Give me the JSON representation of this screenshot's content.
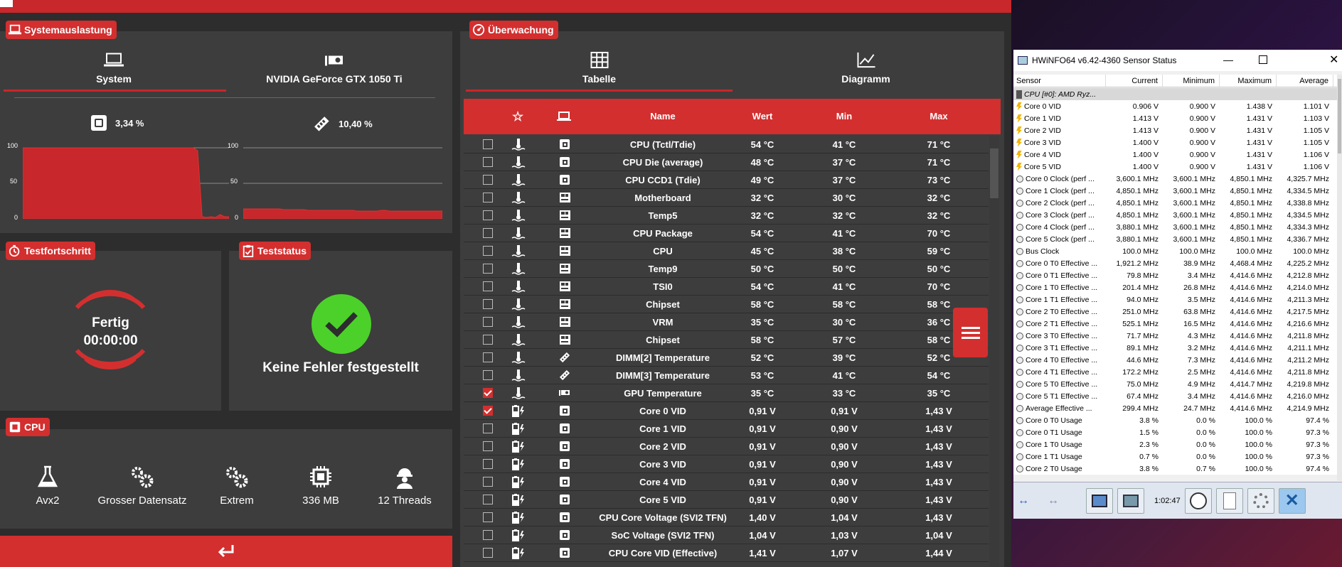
{
  "system_panel": {
    "badge": "Systemauslastung",
    "tabs": [
      {
        "label": "System",
        "icon": "laptop-icon"
      },
      {
        "label": "NVIDIA GeForce GTX 1050 Ti",
        "icon": "gpu-icon"
      }
    ],
    "cpu_usage": "3,34 %",
    "ram_usage": "10,40 %",
    "chart_ticks": [
      "100",
      "50",
      "0"
    ],
    "cpu_chart_values": [
      100,
      100,
      100,
      100,
      100,
      100,
      100,
      100,
      100,
      100,
      100,
      100,
      100,
      100,
      100,
      100,
      100,
      100,
      100,
      100,
      100,
      100,
      100,
      100,
      100,
      100,
      100,
      100,
      100,
      100,
      100,
      100,
      100,
      100,
      100,
      100,
      100,
      100,
      100,
      96,
      3,
      2,
      3,
      2,
      6,
      3,
      3
    ],
    "ram_chart_values": [
      14,
      14,
      14,
      14,
      14,
      14,
      14,
      14,
      14,
      14,
      13,
      13,
      13,
      13,
      13,
      13,
      12,
      12,
      12,
      12,
      12,
      12,
      12,
      12,
      12,
      12,
      12,
      12,
      11,
      11,
      11,
      11,
      11,
      11,
      12,
      12,
      11,
      11,
      11,
      11,
      11,
      11,
      11,
      11,
      11,
      11,
      11,
      11,
      11,
      11
    ]
  },
  "test_progress": {
    "badge": "Testfortschritt",
    "status": "Fertig",
    "time": "00:00:00"
  },
  "test_status": {
    "badge": "Teststatus",
    "message": "Keine Fehler festgestellt"
  },
  "cpu_panel": {
    "badge": "CPU",
    "items": [
      {
        "label": "Avx2",
        "icon": "flask-icon"
      },
      {
        "label": "Grosser Datensatz",
        "icon": "gears-icon"
      },
      {
        "label": "Extrem",
        "icon": "gears-icon"
      },
      {
        "label": "336 MB",
        "icon": "chip-icon"
      },
      {
        "label": "12 Threads",
        "icon": "worker-icon"
      }
    ]
  },
  "monitor": {
    "badge": "Überwachung",
    "tabs": [
      {
        "label": "Tabelle",
        "icon": "grid-icon"
      },
      {
        "label": "Diagramm",
        "icon": "line-chart-icon"
      }
    ],
    "columns": {
      "star": "star-icon",
      "device": "laptop-icon",
      "name": "Name",
      "value": "Wert",
      "min": "Min",
      "max": "Max"
    },
    "rows": [
      {
        "checked": false,
        "type": "temp",
        "dev": "cpu",
        "name": "CPU (Tctl/Tdie)",
        "value": "54 °C",
        "min": "41 °C",
        "max": "71 °C"
      },
      {
        "checked": false,
        "type": "temp",
        "dev": "cpu",
        "name": "CPU Die (average)",
        "value": "48 °C",
        "min": "37 °C",
        "max": "71 °C"
      },
      {
        "checked": false,
        "type": "temp",
        "dev": "cpu",
        "name": "CPU CCD1 (Tdie)",
        "value": "49 °C",
        "min": "37 °C",
        "max": "73 °C"
      },
      {
        "checked": false,
        "type": "temp",
        "dev": "board",
        "name": "Motherboard",
        "value": "32 °C",
        "min": "30 °C",
        "max": "32 °C"
      },
      {
        "checked": false,
        "type": "temp",
        "dev": "board",
        "name": "Temp5",
        "value": "32 °C",
        "min": "32 °C",
        "max": "32 °C"
      },
      {
        "checked": false,
        "type": "temp",
        "dev": "board",
        "name": "CPU Package",
        "value": "54 °C",
        "min": "41 °C",
        "max": "70 °C"
      },
      {
        "checked": false,
        "type": "temp",
        "dev": "board",
        "name": "CPU",
        "value": "45 °C",
        "min": "38 °C",
        "max": "59 °C"
      },
      {
        "checked": false,
        "type": "temp",
        "dev": "board",
        "name": "Temp9",
        "value": "50 °C",
        "min": "50 °C",
        "max": "50 °C"
      },
      {
        "checked": false,
        "type": "temp",
        "dev": "board",
        "name": "TSI0",
        "value": "54 °C",
        "min": "41 °C",
        "max": "70 °C"
      },
      {
        "checked": false,
        "type": "temp",
        "dev": "board",
        "name": "Chipset",
        "value": "58 °C",
        "min": "58 °C",
        "max": "58 °C"
      },
      {
        "checked": false,
        "type": "temp",
        "dev": "board",
        "name": "VRM",
        "value": "35 °C",
        "min": "30 °C",
        "max": "36 °C"
      },
      {
        "checked": false,
        "type": "temp",
        "dev": "board",
        "name": "Chipset",
        "value": "58 °C",
        "min": "57 °C",
        "max": "58 °C"
      },
      {
        "checked": false,
        "type": "temp",
        "dev": "ram",
        "name": "DIMM[2] Temperature",
        "value": "52 °C",
        "min": "39 °C",
        "max": "52 °C"
      },
      {
        "checked": false,
        "type": "temp",
        "dev": "ram",
        "name": "DIMM[3] Temperature",
        "value": "53 °C",
        "min": "41 °C",
        "max": "54 °C"
      },
      {
        "checked": true,
        "type": "temp",
        "dev": "gpu",
        "name": "GPU Temperature",
        "value": "35 °C",
        "min": "33 °C",
        "max": "35 °C"
      },
      {
        "checked": true,
        "type": "volt",
        "dev": "cpu",
        "name": "Core 0 VID",
        "value": "0,91 V",
        "min": "0,91 V",
        "max": "1,43 V"
      },
      {
        "checked": false,
        "type": "volt",
        "dev": "cpu",
        "name": "Core 1 VID",
        "value": "0,91 V",
        "min": "0,90 V",
        "max": "1,43 V"
      },
      {
        "checked": false,
        "type": "volt",
        "dev": "cpu",
        "name": "Core 2 VID",
        "value": "0,91 V",
        "min": "0,90 V",
        "max": "1,43 V"
      },
      {
        "checked": false,
        "type": "volt",
        "dev": "cpu",
        "name": "Core 3 VID",
        "value": "0,91 V",
        "min": "0,90 V",
        "max": "1,43 V"
      },
      {
        "checked": false,
        "type": "volt",
        "dev": "cpu",
        "name": "Core 4 VID",
        "value": "0,91 V",
        "min": "0,90 V",
        "max": "1,43 V"
      },
      {
        "checked": false,
        "type": "volt",
        "dev": "cpu",
        "name": "Core 5 VID",
        "value": "0,91 V",
        "min": "0,90 V",
        "max": "1,43 V"
      },
      {
        "checked": false,
        "type": "volt",
        "dev": "cpu",
        "name": "CPU Core Voltage (SVI2 TFN)",
        "value": "1,40 V",
        "min": "1,04 V",
        "max": "1,43 V"
      },
      {
        "checked": false,
        "type": "volt",
        "dev": "cpu",
        "name": "SoC Voltage (SVI2 TFN)",
        "value": "1,04 V",
        "min": "1,03 V",
        "max": "1,04 V"
      },
      {
        "checked": false,
        "type": "volt",
        "dev": "cpu",
        "name": "CPU Core VID (Effective)",
        "value": "1,41 V",
        "min": "1,07 V",
        "max": "1,44 V"
      }
    ]
  },
  "hwinfo": {
    "title": "HWiNFO64 v6.42-4360 Sensor Status",
    "columns": [
      "Sensor",
      "Current",
      "Minimum",
      "Maximum",
      "Average"
    ],
    "group": "CPU [#0]: AMD Ryz...",
    "rows": [
      {
        "icon": "volt",
        "name": "Core 0 VID",
        "cur": "0.906 V",
        "min": "0.900 V",
        "max": "1.438 V",
        "avg": "1.101 V"
      },
      {
        "icon": "volt",
        "name": "Core 1 VID",
        "cur": "1.413 V",
        "min": "0.900 V",
        "max": "1.431 V",
        "avg": "1.103 V"
      },
      {
        "icon": "volt",
        "name": "Core 2 VID",
        "cur": "1.413 V",
        "min": "0.900 V",
        "max": "1.431 V",
        "avg": "1.105 V"
      },
      {
        "icon": "volt",
        "name": "Core 3 VID",
        "cur": "1.400 V",
        "min": "0.900 V",
        "max": "1.431 V",
        "avg": "1.105 V"
      },
      {
        "icon": "volt",
        "name": "Core 4 VID",
        "cur": "1.400 V",
        "min": "0.900 V",
        "max": "1.431 V",
        "avg": "1.106 V"
      },
      {
        "icon": "volt",
        "name": "Core 5 VID",
        "cur": "1.400 V",
        "min": "0.900 V",
        "max": "1.431 V",
        "avg": "1.106 V"
      },
      {
        "icon": "clock",
        "name": "Core 0 Clock (perf ...",
        "cur": "3,600.1 MHz",
        "min": "3,600.1 MHz",
        "max": "4,850.1 MHz",
        "avg": "4,325.7 MHz"
      },
      {
        "icon": "clock",
        "name": "Core 1 Clock (perf ...",
        "cur": "4,850.1 MHz",
        "min": "3,600.1 MHz",
        "max": "4,850.1 MHz",
        "avg": "4,334.5 MHz"
      },
      {
        "icon": "clock",
        "name": "Core 2 Clock (perf ...",
        "cur": "4,850.1 MHz",
        "min": "3,600.1 MHz",
        "max": "4,850.1 MHz",
        "avg": "4,338.8 MHz"
      },
      {
        "icon": "clock",
        "name": "Core 3 Clock (perf ...",
        "cur": "4,850.1 MHz",
        "min": "3,600.1 MHz",
        "max": "4,850.1 MHz",
        "avg": "4,334.5 MHz"
      },
      {
        "icon": "clock",
        "name": "Core 4 Clock (perf ...",
        "cur": "3,880.1 MHz",
        "min": "3,600.1 MHz",
        "max": "4,850.1 MHz",
        "avg": "4,334.3 MHz"
      },
      {
        "icon": "clock",
        "name": "Core 5 Clock (perf ...",
        "cur": "3,880.1 MHz",
        "min": "3,600.1 MHz",
        "max": "4,850.1 MHz",
        "avg": "4,336.7 MHz"
      },
      {
        "icon": "clock",
        "name": "Bus Clock",
        "cur": "100.0 MHz",
        "min": "100.0 MHz",
        "max": "100.0 MHz",
        "avg": "100.0 MHz"
      },
      {
        "icon": "clock",
        "name": "Core 0 T0 Effective ...",
        "cur": "1,921.2 MHz",
        "min": "38.9 MHz",
        "max": "4,468.4 MHz",
        "avg": "4,225.2 MHz"
      },
      {
        "icon": "clock",
        "name": "Core 0 T1 Effective ...",
        "cur": "79.8 MHz",
        "min": "3.4 MHz",
        "max": "4,414.6 MHz",
        "avg": "4,212.8 MHz"
      },
      {
        "icon": "clock",
        "name": "Core 1 T0 Effective ...",
        "cur": "201.4 MHz",
        "min": "26.8 MHz",
        "max": "4,414.6 MHz",
        "avg": "4,214.0 MHz"
      },
      {
        "icon": "clock",
        "name": "Core 1 T1 Effective ...",
        "cur": "94.0 MHz",
        "min": "3.5 MHz",
        "max": "4,414.6 MHz",
        "avg": "4,211.3 MHz"
      },
      {
        "icon": "clock",
        "name": "Core 2 T0 Effective ...",
        "cur": "251.0 MHz",
        "min": "63.8 MHz",
        "max": "4,414.6 MHz",
        "avg": "4,217.5 MHz"
      },
      {
        "icon": "clock",
        "name": "Core 2 T1 Effective ...",
        "cur": "525.1 MHz",
        "min": "16.5 MHz",
        "max": "4,414.6 MHz",
        "avg": "4,216.6 MHz"
      },
      {
        "icon": "clock",
        "name": "Core 3 T0 Effective ...",
        "cur": "71.7 MHz",
        "min": "4.3 MHz",
        "max": "4,414.6 MHz",
        "avg": "4,211.8 MHz"
      },
      {
        "icon": "clock",
        "name": "Core 3 T1 Effective ...",
        "cur": "89.1 MHz",
        "min": "3.2 MHz",
        "max": "4,414.6 MHz",
        "avg": "4,211.1 MHz"
      },
      {
        "icon": "clock",
        "name": "Core 4 T0 Effective ...",
        "cur": "44.6 MHz",
        "min": "7.3 MHz",
        "max": "4,414.6 MHz",
        "avg": "4,211.2 MHz"
      },
      {
        "icon": "clock",
        "name": "Core 4 T1 Effective ...",
        "cur": "172.2 MHz",
        "min": "2.5 MHz",
        "max": "4,414.6 MHz",
        "avg": "4,211.8 MHz"
      },
      {
        "icon": "clock",
        "name": "Core 5 T0 Effective ...",
        "cur": "75.0 MHz",
        "min": "4.9 MHz",
        "max": "4,414.7 MHz",
        "avg": "4,219.8 MHz"
      },
      {
        "icon": "clock",
        "name": "Core 5 T1 Effective ...",
        "cur": "67.4 MHz",
        "min": "3.4 MHz",
        "max": "4,414.6 MHz",
        "avg": "4,216.0 MHz"
      },
      {
        "icon": "clock",
        "name": "Average Effective ...",
        "cur": "299.4 MHz",
        "min": "24.7 MHz",
        "max": "4,414.6 MHz",
        "avg": "4,214.9 MHz"
      },
      {
        "icon": "clock",
        "name": "Core 0 T0 Usage",
        "cur": "3.8 %",
        "min": "0.0 %",
        "max": "100.0 %",
        "avg": "97.4 %"
      },
      {
        "icon": "clock",
        "name": "Core 0 T1 Usage",
        "cur": "1.5 %",
        "min": "0.0 %",
        "max": "100.0 %",
        "avg": "97.3 %"
      },
      {
        "icon": "clock",
        "name": "Core 1 T0 Usage",
        "cur": "2.3 %",
        "min": "0.0 %",
        "max": "100.0 %",
        "avg": "97.3 %"
      },
      {
        "icon": "clock",
        "name": "Core 1 T1 Usage",
        "cur": "0.7 %",
        "min": "0.0 %",
        "max": "100.0 %",
        "avg": "97.3 %"
      },
      {
        "icon": "clock",
        "name": "Core 2 T0 Usage",
        "cur": "3.8 %",
        "min": "0.7 %",
        "max": "100.0 %",
        "avg": "97.4 %"
      }
    ],
    "elapsed": "1:02:47"
  },
  "colors": {
    "accent": "#d32f2f",
    "panel": "#3d3d3d",
    "background": "#2d2d2d",
    "ok": "#4cd12b"
  }
}
